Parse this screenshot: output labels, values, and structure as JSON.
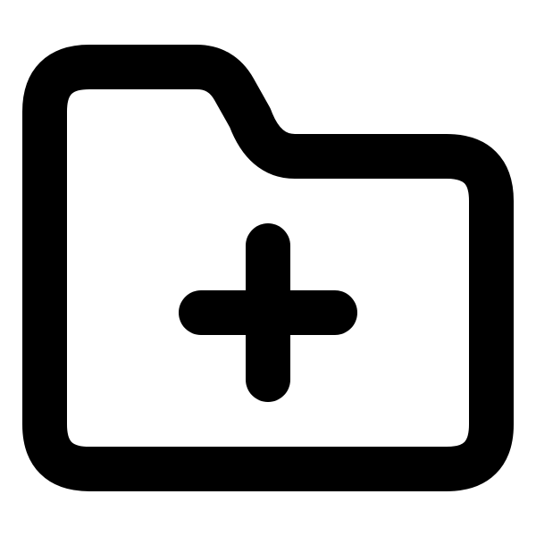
{
  "icon": {
    "name": "folder-plus-icon",
    "stroke_color": "#000000",
    "background_color": "#ffffff"
  }
}
